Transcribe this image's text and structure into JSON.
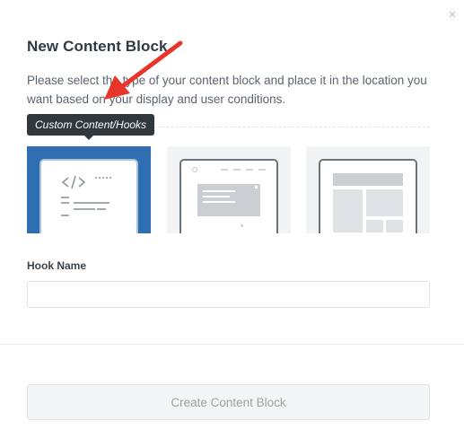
{
  "modal": {
    "title": "New Content Block",
    "description": "Please select the type of your content block and place it in the location you want based on your display and user conditions.",
    "tooltip": "Custom Content/Hooks",
    "hook_name_label": "Hook Name",
    "hook_name_value": "",
    "hook_name_placeholder": "",
    "create_button_label": "Create Content Block"
  },
  "block_types": [
    {
      "id": "custom-content-hooks",
      "selected": true
    },
    {
      "id": "popup",
      "selected": false
    },
    {
      "id": "layout",
      "selected": false
    }
  ],
  "colors": {
    "selected_card": "#2f6eb0",
    "card_bg": "#f1f3f5",
    "tooltip_bg": "#30373d",
    "annotation_arrow": "#e8352b"
  },
  "icons": [
    "close-icon",
    "code-icon",
    "popup-icon",
    "layout-icon",
    "annotation-arrow"
  ]
}
